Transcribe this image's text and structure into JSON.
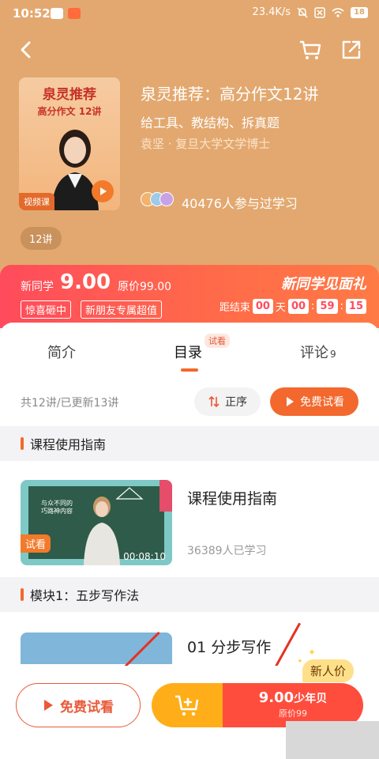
{
  "status": {
    "time": "10:52",
    "network_speed": "23.4K/s",
    "battery": "18"
  },
  "course": {
    "cover_title_line1": "泉灵推荐",
    "cover_title_line2": "高分作文 12讲",
    "cover_tag": "视频课",
    "title": "泉灵推荐：高分作文12讲",
    "subtitle": "给工具、教结构、拆真题",
    "author": "袁坚 · 复旦大学文学博士",
    "participants": "40476人参与过学习",
    "lessons_chip": "12讲"
  },
  "promo": {
    "price_label": "新同学",
    "price": "9.00",
    "original_price": "原价99.00",
    "tag1": "惊喜砸中",
    "tag2": "新朋友专属超值",
    "title": "新同学见面礼",
    "countdown_label": "距结束",
    "countdown_days": "00",
    "days_unit": "天",
    "countdown_hours": "00",
    "countdown_minutes": "59",
    "countdown_seconds": "15"
  },
  "tabs": {
    "intro": "简介",
    "catalog": "目录",
    "catalog_badge": "试看",
    "comments": "评论",
    "comments_count": "9"
  },
  "catalog": {
    "info": "共12讲/已更新13讲",
    "sort_label": "正序",
    "free_trial_label": "免费试看"
  },
  "sections": [
    {
      "title": "课程使用指南",
      "lesson": {
        "title": "课程使用指南",
        "count": "36389人已学习",
        "duration": "00:08:10",
        "trial_tag": "试看"
      }
    },
    {
      "title": "模块1：五步写作法",
      "lesson": {
        "title": "01 分步写作"
      }
    }
  ],
  "bottom_bar": {
    "free_trial": "免费试看",
    "price": "9.00",
    "price_unit": "少年贝",
    "original": "原价99",
    "new_badge": "新人价"
  },
  "colors": {
    "header": "#e3a86f",
    "accent": "#f3682d",
    "promo_red": "#ff4b5c",
    "cart_yellow": "#ffae1a"
  }
}
